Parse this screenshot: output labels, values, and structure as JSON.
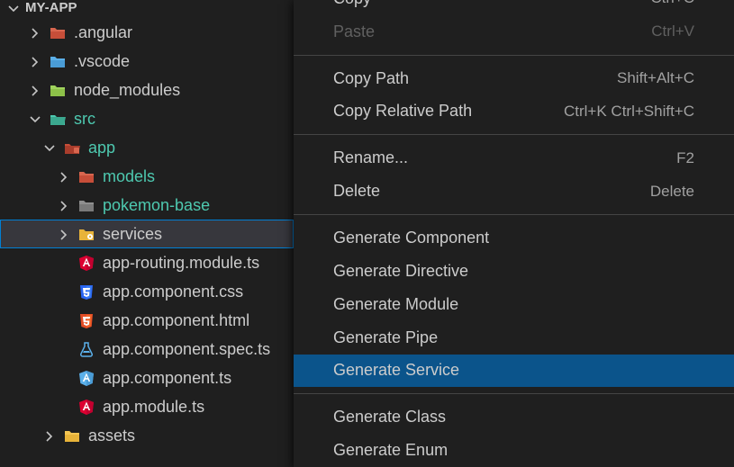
{
  "header": {
    "title": "MY-APP"
  },
  "tree": {
    "angular": ".angular",
    "vscode": ".vscode",
    "node_modules": "node_modules",
    "src": "src",
    "app": "app",
    "models": "models",
    "pokemon_base": "pokemon-base",
    "services": "services",
    "app_routing": "app-routing.module.ts",
    "app_css": "app.component.css",
    "app_html": "app.component.html",
    "app_spec": "app.component.spec.ts",
    "app_ts": "app.component.ts",
    "app_module": "app.module.ts",
    "assets": "assets"
  },
  "menu": {
    "copy": "Copy",
    "copy_sc": "Ctrl+C",
    "paste": "Paste",
    "paste_sc": "Ctrl+V",
    "copy_path": "Copy Path",
    "copy_path_sc": "Shift+Alt+C",
    "copy_rel": "Copy Relative Path",
    "copy_rel_sc": "Ctrl+K Ctrl+Shift+C",
    "rename": "Rename...",
    "rename_sc": "F2",
    "delete": "Delete",
    "delete_sc": "Delete",
    "gen_component": "Generate Component",
    "gen_directive": "Generate Directive",
    "gen_module": "Generate Module",
    "gen_pipe": "Generate Pipe",
    "gen_service": "Generate Service",
    "gen_class": "Generate Class",
    "gen_enum": "Generate Enum"
  }
}
